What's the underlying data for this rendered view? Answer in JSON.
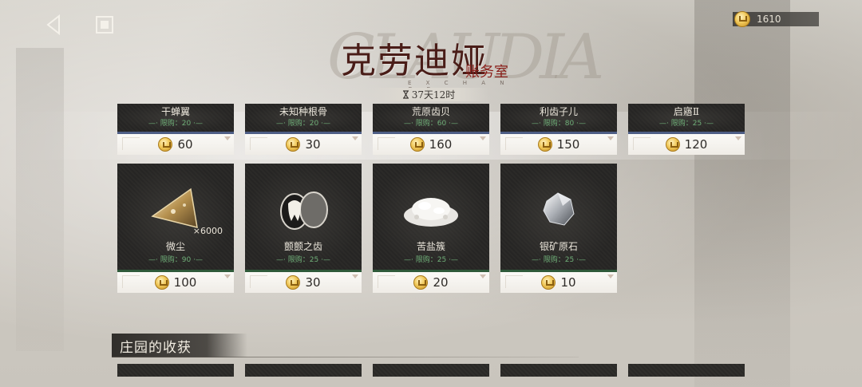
{
  "topbar": {
    "back_icon": "back-arrow-icon",
    "home_icon": "home-square-icon",
    "currency_amount": "1610"
  },
  "title": {
    "main": "克劳迪娅",
    "sub": "账务室",
    "decor_letters": "CLAUDIA",
    "english": "E X C H A N G E"
  },
  "timer": {
    "icon": "hourglass-icon",
    "text": "37天12时"
  },
  "shop_row1": [
    {
      "name": "干蝉翼",
      "limit": "—· 限购：20 ·—",
      "price": "60"
    },
    {
      "name": "未知种根骨",
      "limit": "—· 限购：20 ·—",
      "price": "30"
    },
    {
      "name": "荒原齿贝",
      "limit": "—· 限购：60 ·—",
      "price": "160"
    },
    {
      "name": "利齿子儿",
      "limit": "—· 限购：80 ·—",
      "price": "150"
    },
    {
      "name": "启寤Ⅱ",
      "limit": "—· 限购：25 ·—",
      "price": "120"
    }
  ],
  "shop_row2": [
    {
      "name": "微尘",
      "limit": "—· 限购：90 ·—",
      "price": "100",
      "quantity": "×6000",
      "icon": "crystal-shard-icon"
    },
    {
      "name": "颤颤之齿",
      "limit": "—· 限购：25 ·—",
      "price": "30",
      "quantity": "",
      "icon": "tooth-locket-icon"
    },
    {
      "name": "苦盐簇",
      "limit": "—· 限购：25 ·—",
      "price": "20",
      "quantity": "",
      "icon": "salt-pile-icon"
    },
    {
      "name": "银矿原石",
      "limit": "—· 限购：25 ·—",
      "price": "10",
      "quantity": "",
      "icon": "silver-ore-icon"
    }
  ],
  "section": {
    "title": "庄园的收获"
  },
  "colors": {
    "title": "#4a1d18",
    "subtitle": "#8a1f1a",
    "limit_text": "#6fae78",
    "row1_accent": "#4e5e86",
    "row2_accent": "#2f5a3a"
  }
}
